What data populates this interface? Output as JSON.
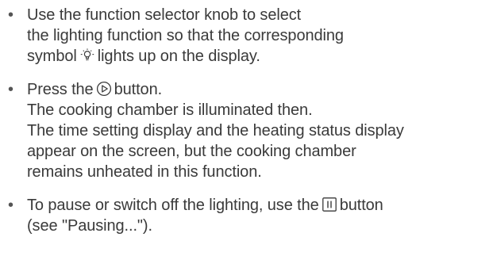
{
  "instructions": {
    "bullet_char": "•",
    "step1": {
      "line1": "Use the function selector knob to select",
      "line2": "the lighting function so that the corresponding",
      "line3_before": "symbol",
      "line3_after": "lights up on the display.",
      "icon": "lamp-icon"
    },
    "step2": {
      "line1_before": "Press the",
      "line1_after": "button.",
      "icon": "start-button-icon",
      "line2": "The cooking chamber is illuminated then.",
      "line3": "The time setting display and the heating status display",
      "line4": "appear on the screen, but the cooking chamber",
      "line5": "remains unheated in this function."
    },
    "step3": {
      "line1_before": "To pause or switch off the lighting, use the",
      "line1_after": "button",
      "icon": "pause-button-icon",
      "line2": "(see \"Pausing...\")."
    }
  }
}
